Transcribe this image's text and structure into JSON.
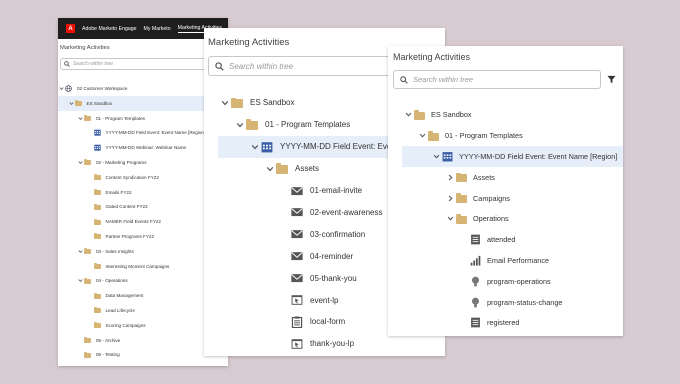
{
  "back_panel": {
    "nav": {
      "logo_glyph": "A",
      "items": [
        "Adobe Marketo Engage",
        "My Marketo",
        "Marketing Activities"
      ],
      "active_index": 2
    },
    "title": "Marketing Activities",
    "search_placeholder": "Search within tree",
    "tree": [
      {
        "label": "02 Customer Workspace",
        "icon": "globe-icon",
        "chev": "down",
        "level": 0
      },
      {
        "label": "ES Sandbox",
        "icon": "folder-icon",
        "chev": "down",
        "level": 1,
        "selected": true
      },
      {
        "label": "01 - Program Templates",
        "icon": "folder-icon",
        "chev": "down",
        "level": 2
      },
      {
        "label": "YYYY-MM-DD Field Event: Event Name [Region]",
        "icon": "event-program-icon",
        "chev": "",
        "level": 3
      },
      {
        "label": "YYYY-MM-DD Webinar: Webinar Name",
        "icon": "event-program-icon",
        "chev": "",
        "level": 3
      },
      {
        "label": "02 - Marketing Programs",
        "icon": "folder-icon",
        "chev": "down",
        "level": 2
      },
      {
        "label": "Content Syndication FY22",
        "icon": "folder-icon",
        "chev": "",
        "level": 3
      },
      {
        "label": "Emails FY22",
        "icon": "folder-icon",
        "chev": "",
        "level": 3
      },
      {
        "label": "Gated Content FY22",
        "icon": "folder-icon",
        "chev": "",
        "level": 3
      },
      {
        "label": "NAMER Field Events FY22",
        "icon": "folder-icon",
        "chev": "",
        "level": 3
      },
      {
        "label": "Partner Programs FY22",
        "icon": "folder-icon",
        "chev": "",
        "level": 3
      },
      {
        "label": "03 - Sales Insights",
        "icon": "folder-icon",
        "chev": "down",
        "level": 2
      },
      {
        "label": "Interesting Moment Campaigns",
        "icon": "folder-icon",
        "chev": "",
        "level": 3
      },
      {
        "label": "04 - Operations",
        "icon": "folder-icon",
        "chev": "down",
        "level": 2
      },
      {
        "label": "Data Management",
        "icon": "folder-icon",
        "chev": "",
        "level": 3
      },
      {
        "label": "Lead Lifecycle",
        "icon": "folder-icon",
        "chev": "",
        "level": 3
      },
      {
        "label": "Scoring Campaigns",
        "icon": "folder-icon",
        "chev": "",
        "level": 3
      },
      {
        "label": "05 - Archive",
        "icon": "folder-icon",
        "chev": "",
        "level": 2
      },
      {
        "label": "06 - Testing",
        "icon": "folder-icon",
        "chev": "",
        "level": 2
      }
    ]
  },
  "middle_panel": {
    "title": "Marketing Activities",
    "search_placeholder": "Search within tree",
    "tree": [
      {
        "label": "ES Sandbox",
        "icon": "folder-icon",
        "chev": "down",
        "level": 0
      },
      {
        "label": "01 - Program Templates",
        "icon": "folder-icon",
        "chev": "down",
        "level": 1
      },
      {
        "label": "YYYY-MM-DD Field Event: Event Name [Region]",
        "icon": "event-program-icon",
        "chev": "down",
        "level": 2,
        "selected": true
      },
      {
        "label": "Assets",
        "icon": "folder-icon",
        "chev": "down",
        "level": 3
      },
      {
        "label": "01-email-invite",
        "icon": "email-icon",
        "chev": "",
        "level": 4
      },
      {
        "label": "02-event-awareness",
        "icon": "email-icon",
        "chev": "",
        "level": 4
      },
      {
        "label": "03-confirmation",
        "icon": "email-icon",
        "chev": "",
        "level": 4
      },
      {
        "label": "04-reminder",
        "icon": "email-icon",
        "chev": "",
        "level": 4
      },
      {
        "label": "05-thank-you",
        "icon": "email-icon",
        "chev": "",
        "level": 4
      },
      {
        "label": "event-lp",
        "icon": "landing-page-icon",
        "chev": "",
        "level": 4
      },
      {
        "label": "local-form",
        "icon": "form-icon",
        "chev": "",
        "level": 4
      },
      {
        "label": "thank-you-lp",
        "icon": "landing-page-icon",
        "chev": "",
        "level": 4
      }
    ]
  },
  "front_panel": {
    "title": "Marketing Activities",
    "search_placeholder": "Search within tree",
    "filter_icon": "filter-icon",
    "tree": [
      {
        "label": "ES Sandbox",
        "icon": "folder-icon",
        "chev": "down",
        "level": 0
      },
      {
        "label": "01 - Program Templates",
        "icon": "folder-icon",
        "chev": "down",
        "level": 1
      },
      {
        "label": "YYYY-MM-DD Field Event: Event Name [Region]",
        "icon": "event-program-icon",
        "chev": "down",
        "level": 2,
        "selected": true
      },
      {
        "label": "Assets",
        "icon": "folder-icon",
        "chev": "right",
        "level": 3
      },
      {
        "label": "Campaigns",
        "icon": "folder-icon",
        "chev": "right",
        "level": 3
      },
      {
        "label": "Operations",
        "icon": "folder-icon",
        "chev": "down",
        "level": 3
      },
      {
        "label": "attended",
        "icon": "smart-list-icon",
        "chev": "",
        "level": 4
      },
      {
        "label": "Email Performance",
        "icon": "report-icon",
        "chev": "",
        "level": 4
      },
      {
        "label": "program-operations",
        "icon": "smart-campaign-icon",
        "chev": "",
        "level": 4
      },
      {
        "label": "program-status-change",
        "icon": "smart-campaign-icon",
        "chev": "",
        "level": 4
      },
      {
        "label": "registered",
        "icon": "smart-list-icon",
        "chev": "",
        "level": 4
      }
    ]
  },
  "colors": {
    "background": "#d7cbd1",
    "folder": "#d6b474",
    "program_icon": "#3a5da6",
    "selected_row": "#e5eef9",
    "nav_bar": "#1e1e1e",
    "logo_red": "#eb1000"
  }
}
